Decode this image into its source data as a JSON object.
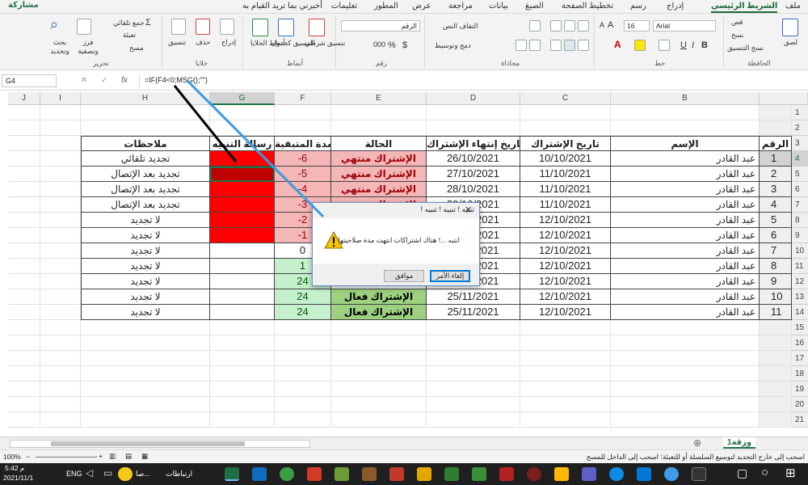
{
  "tabs": [
    "ملف",
    "الشريط الرئيسي",
    "إدراج",
    "رسم",
    "تخطيط الصفحة",
    "الصيغ",
    "بيانات",
    "مراجعة",
    "عرض",
    "المطور",
    "تعليمات",
    "أخبرني بما تريد القيام به"
  ],
  "share": "مشاركة",
  "ribbon": {
    "paste": "لصق",
    "cut": "قص",
    "copy": "نسخ",
    "format_painter": "نسخ التنسيق",
    "clipboard_group": "الحافظة",
    "font_name": "Arial",
    "font_size": "16",
    "font_group": "خط",
    "wrap": "التفاف النص",
    "merge": "دمج وتوسيط",
    "align_group": "محاذاة",
    "number_format": "الرقم",
    "number_group": "رقم",
    "cond_format": "تنسيق شرطي",
    "table_format": "التنسيق كجدول",
    "cell_styles": "أنماط الخلايا",
    "styles_group": "أنماط",
    "insert": "إدراج",
    "delete": "حذف",
    "format": "تنسيق",
    "cells_group": "خلايا",
    "autosum": "جمع تلقائي",
    "fill": "تعبئة",
    "clear": "مسح",
    "sort": "فرز وتصفية",
    "find": "بحث وتحديد",
    "edit_group": "تحرير"
  },
  "namebox": "G4",
  "formula": "=IF(F4<0;MSG();\"\")",
  "columns": [
    {
      "id": "A",
      "label": "A"
    },
    {
      "id": "B",
      "label": "B"
    },
    {
      "id": "C",
      "label": "C"
    },
    {
      "id": "D",
      "label": "D"
    },
    {
      "id": "E",
      "label": "E"
    },
    {
      "id": "F",
      "label": "F"
    },
    {
      "id": "G",
      "label": "G"
    },
    {
      "id": "H",
      "label": "H"
    },
    {
      "id": "I",
      "label": "I"
    },
    {
      "id": "J",
      "label": "J"
    }
  ],
  "rows": [
    "1",
    "2",
    "3",
    "4",
    "5",
    "6",
    "7",
    "8",
    "9",
    "10",
    "11",
    "12",
    "13",
    "14",
    "15",
    "16",
    "17",
    "18",
    "19",
    "20",
    "21"
  ],
  "headers": {
    "A": "الرقم",
    "B": "الإسم",
    "C": "تاريخ الإشتراك",
    "D": "تاريخ إنتهاء الإشتراك",
    "E": "الحالة",
    "F": "المدة المتبقية",
    "G": "رسالة التنبيه",
    "H": "ملاحظات"
  },
  "table": [
    {
      "A": "1",
      "B": "عبد القادر",
      "C": "10/10/2021",
      "D": "26/10/2021",
      "E": "الإشتراك منتهي",
      "F": "-6",
      "G": "",
      "H": "تجديد تلقائي"
    },
    {
      "A": "2",
      "B": "عبد القادر",
      "C": "11/10/2021",
      "D": "27/10/2021",
      "E": "الإشتراك منتهي",
      "F": "-5",
      "G": "",
      "H": "تجديد بعد الإتصال"
    },
    {
      "A": "3",
      "B": "عبد القادر",
      "C": "11/10/2021",
      "D": "28/10/2021",
      "E": "الإشتراك منتهي",
      "F": "-4",
      "G": "",
      "H": "تجديد بعد الإتصال"
    },
    {
      "A": "4",
      "B": "عبد القادر",
      "C": "11/10/2021",
      "D": "29/10/2021",
      "E": "الإشتراك منتهي",
      "F": "-3",
      "G": "",
      "H": "تجديد بعد الإتصال"
    },
    {
      "A": "5",
      "B": "عبد القادر",
      "C": "12/10/2021",
      "D": "30/10/2021",
      "E": "الإشتراك منتهي",
      "F": "-2",
      "G": "",
      "H": "لا تجديد"
    },
    {
      "A": "6",
      "B": "عبد القادر",
      "C": "12/10/2021",
      "D": "31/10/2021",
      "E": "الإشتراك منتهي",
      "F": "-1",
      "G": "",
      "H": "لا تجديد"
    },
    {
      "A": "7",
      "B": "عبد القادر",
      "C": "12/10/2021",
      "D": "01/11/2021",
      "E": "",
      "F": "0",
      "G": "",
      "H": "لا تجديد"
    },
    {
      "A": "8",
      "B": "عبد القادر",
      "C": "12/10/2021",
      "D": "02/11/2021",
      "E": "",
      "F": "1",
      "G": "",
      "H": "لا تجديد"
    },
    {
      "A": "9",
      "B": "عبد القادر",
      "C": "12/10/2021",
      "D": "25/11/2021",
      "E": "",
      "F": "24",
      "G": "",
      "H": "لا تجديد"
    },
    {
      "A": "10",
      "B": "عبد القادر",
      "C": "12/10/2021",
      "D": "25/11/2021",
      "E": "الإشتراك فعال",
      "F": "24",
      "G": "",
      "H": "لا تجديد"
    },
    {
      "A": "11",
      "B": "عبد القادر",
      "C": "12/10/2021",
      "D": "25/11/2021",
      "E": "الإشتراك فعال",
      "F": "24",
      "G": "",
      "H": "لا تجديد"
    }
  ],
  "colors": {
    "expired": "#f4b6b6",
    "expired_text": "#9c0006",
    "alert": "#ff0000",
    "active": "#9dd07f",
    "positive": "#c6efce",
    "accent": "#217346"
  },
  "dialog": {
    "title": "! تنبيه ! تنبيه ! تنبيه",
    "message": "انتبه ...! هناك اشتراكات انتهت مدة صلاحيتها",
    "ok": "موافق",
    "cancel": "إلغاء الأمر"
  },
  "sheet_tab": "ورقة1",
  "status": {
    "left": "100%",
    "hint": "اسحب إلى خارج التحديد لتوسيع السلسلة أو للتعبئة؛ اسحب إلى الداخل للمسح"
  },
  "taskbar": {
    "time": "5:42 م",
    "date": "2021/11/1",
    "lang": "ENG",
    "app1": "ارتباطات",
    "app2": "صا..."
  }
}
